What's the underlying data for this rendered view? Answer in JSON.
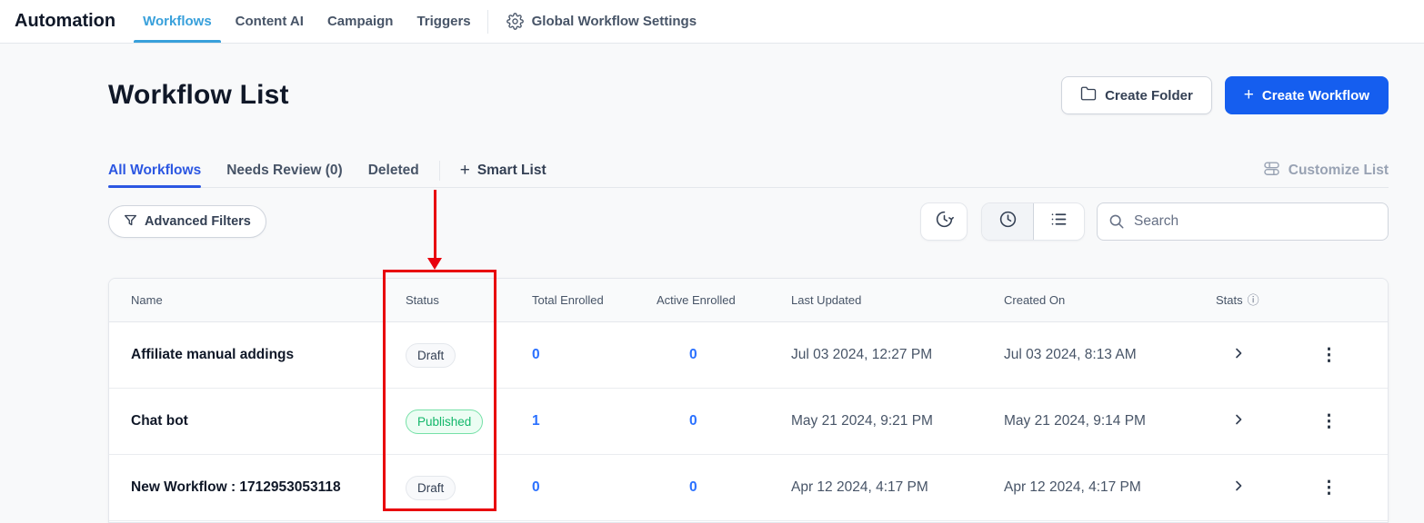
{
  "topbar": {
    "app_title": "Automation",
    "tabs": [
      {
        "label": "Workflows",
        "active": true
      },
      {
        "label": "Content AI",
        "active": false
      },
      {
        "label": "Campaign",
        "active": false
      },
      {
        "label": "Triggers",
        "active": false
      }
    ],
    "settings_label": "Global Workflow Settings"
  },
  "header": {
    "title": "Workflow List",
    "create_folder_label": "Create Folder",
    "create_workflow_label": "Create Workflow"
  },
  "list_tabs": {
    "items": [
      {
        "label": "All Workflows",
        "active": true
      },
      {
        "label": "Needs Review (0)",
        "active": false
      },
      {
        "label": "Deleted",
        "active": false
      }
    ],
    "smart_list_label": "Smart List",
    "customize_list_label": "Customize List"
  },
  "toolbar": {
    "advanced_filters_label": "Advanced Filters",
    "search_placeholder": "Search",
    "search_value": ""
  },
  "table": {
    "columns": [
      "Name",
      "Status",
      "Total Enrolled",
      "Active Enrolled",
      "Last Updated",
      "Created On",
      "Stats"
    ],
    "rows": [
      {
        "name": "Affiliate manual addings",
        "status": "Draft",
        "status_type": "draft",
        "total_enrolled": "0",
        "active_enrolled": "0",
        "last_updated": "Jul 03 2024, 12:27 PM",
        "created_on": "Jul 03 2024, 8:13 AM"
      },
      {
        "name": "Chat bot",
        "status": "Published",
        "status_type": "published",
        "total_enrolled": "1",
        "active_enrolled": "0",
        "last_updated": "May 21 2024, 9:21 PM",
        "created_on": "May 21 2024, 9:14 PM"
      },
      {
        "name": "New Workflow : 1712953053118",
        "status": "Draft",
        "status_type": "draft",
        "total_enrolled": "0",
        "active_enrolled": "0",
        "last_updated": "Apr 12 2024, 4:17 PM",
        "created_on": "Apr 12 2024, 4:17 PM"
      }
    ]
  },
  "annotation": {
    "type": "red-box-and-arrow",
    "highlighted_column": "Status",
    "color": "#e8000d"
  },
  "icons": {
    "settings": "gear",
    "create_folder": "folder",
    "create_workflow": "plus",
    "smart_list": "plus",
    "customize_list": "sliders",
    "advanced_filters": "funnel",
    "view_history": "clock-with-arrow",
    "view_time": "clock",
    "view_list": "bulleted-list",
    "search": "magnifier",
    "stats_info": "info-circle",
    "row_open": "chevron-right",
    "row_menu": "kebab-vertical-dots"
  },
  "colors": {
    "primary_button_blue": "#155eef",
    "nav_active_blue": "#38a0db",
    "tab_active_blue": "#2c57e2",
    "link_blue": "#2970ff",
    "published_green": "#12b76a",
    "annotation_red": "#e8000d"
  }
}
